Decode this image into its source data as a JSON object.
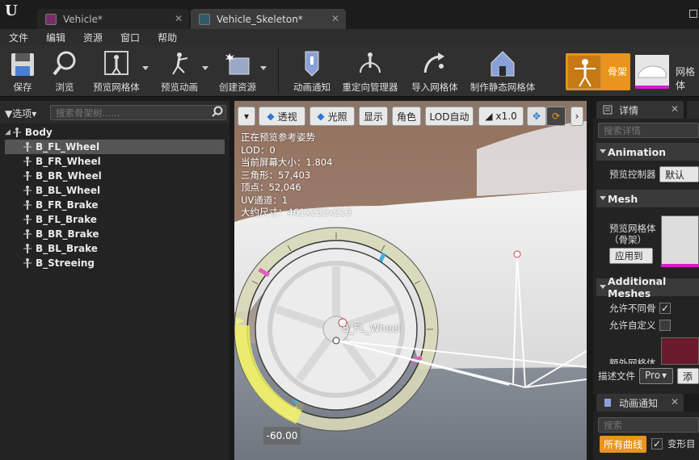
{
  "window": {
    "tabs": [
      {
        "label": "Vehicle*",
        "close": "✕"
      },
      {
        "label": "Vehicle_Skeleton*",
        "close": "✕"
      }
    ]
  },
  "menu": [
    "文件",
    "编辑",
    "资源",
    "窗口",
    "帮助"
  ],
  "toolbar": {
    "buttons": [
      {
        "label": "保存",
        "icon": "save-icon"
      },
      {
        "label": "浏览",
        "icon": "browse-icon"
      },
      {
        "label": "预览网格体",
        "icon": "preview-mesh-icon"
      },
      {
        "label": "预览动画",
        "icon": "preview-animation-icon"
      },
      {
        "label": "创建资源",
        "icon": "create-asset-icon"
      },
      {
        "label": "动画通知",
        "icon": "anim-notify-icon"
      },
      {
        "label": "重定向管理器",
        "icon": "retarget-manager-icon"
      },
      {
        "label": "导入网格体",
        "icon": "import-mesh-icon"
      },
      {
        "label": "制作静态网格体",
        "icon": "make-static-mesh-icon"
      }
    ],
    "mode_skeleton": "骨架",
    "mode_mesh": "网格体"
  },
  "skeleton_tree": {
    "options_label": "选项",
    "search_placeholder": "搜索骨架树......",
    "bones": [
      "Body",
      "B_FL_Wheel",
      "B_FR_Wheel",
      "B_BR_Wheel",
      "B_BL_Wheel",
      "B_FR_Brake",
      "B_FL_Brake",
      "B_BR_Brake",
      "B_BL_Brake",
      "B_Streeing"
    ],
    "selected_bone": "B_FL_Wheel"
  },
  "viewport": {
    "toolbar": {
      "perspective": "透视",
      "lighting": "光照",
      "show": "显示",
      "character": "角色",
      "lod": "LOD自动",
      "speed": "x1.0",
      "more": "›"
    },
    "info": [
      "正在预览参考姿势",
      "LOD：0",
      "当前屏幕大小：1.804",
      "三角形：57,403",
      "顶点：52,046",
      "UV通道：1",
      "大约尺寸：461x232x213"
    ],
    "bone_label": "B_FL_Wheel",
    "rotation_readout": "-60.00"
  },
  "details": {
    "tab_label": "详情",
    "search_placeholder": "搜索详情",
    "animation_header": "Animation",
    "preview_controller_label": "预览控制器",
    "preview_controller_value": "默认",
    "mesh_header": "Mesh",
    "preview_mesh_label": "预览网格体（骨架）",
    "apply_button": "应用到骨",
    "additional_meshes_header": "Additional Meshes",
    "allow_different_label": "允许不同骨",
    "allow_different_checked": true,
    "allow_custom_label": "允许自定义",
    "allow_custom_checked": false,
    "extra_mesh_label": "额外网格体",
    "describe_file_label": "描述文件",
    "describe_file_value": "Pro",
    "add_button": "添加"
  },
  "anim_notify": {
    "tab_label": "动画通知",
    "search_placeholder": "搜索",
    "all_curves_button": "所有曲线",
    "morph_label": "变形目",
    "morph_checked": true
  },
  "colors": {
    "accent_orange": "#e8941e",
    "mesh_magenta": "#d41bd4",
    "gizmo_yellow": "#f0f060"
  }
}
